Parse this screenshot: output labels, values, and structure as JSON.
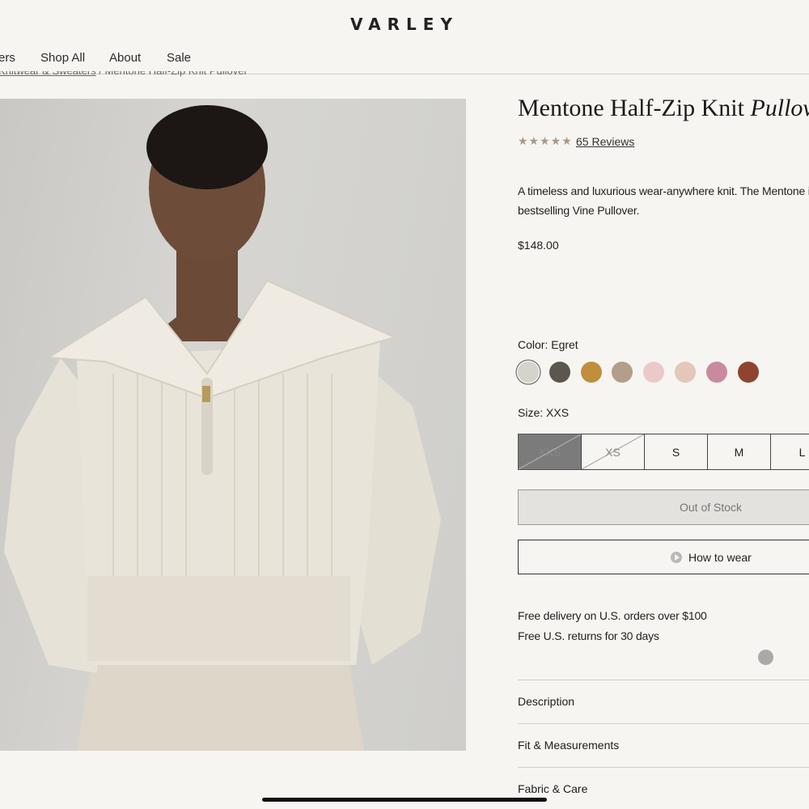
{
  "header": {
    "brand": "VARLEY",
    "nav": [
      "ers",
      "Shop All",
      "About",
      "Sale"
    ]
  },
  "breadcrumb": {
    "link": "Knitwear & Sweaters",
    "separator": "/",
    "current": "Mentone Half-Zip Knit Pullover"
  },
  "product": {
    "title_main": "Mentone Half-Zip Knit ",
    "title_italic": "Pullov",
    "rating": 4.5,
    "stars": "★★★★★",
    "reviews_label": "65 Reviews",
    "description": "A timeless and luxurious wear-anywhere knit. The Mentone is bestselling Vine Pullover.",
    "price": "$148.00",
    "color_label": "Color: Egret",
    "colors": [
      "#d6d3cb",
      "#5c574e",
      "#c08f3c",
      "#b29e8b",
      "#ebc9c9",
      "#e3c7b8",
      "#c98aa0",
      "#8f4330"
    ],
    "size_label": "Size: XXS",
    "sizes": [
      "XXS",
      "XS",
      "S",
      "M",
      "L"
    ],
    "out_of_stock_label": "Out of Stock",
    "how_to_wear_label": "How to wear",
    "shipping_1": "Free delivery on U.S. orders over $100",
    "shipping_2": "Free U.S. returns for 30 days",
    "accordions": [
      "Description",
      "Fit & Measurements",
      "Fabric & Care"
    ]
  }
}
